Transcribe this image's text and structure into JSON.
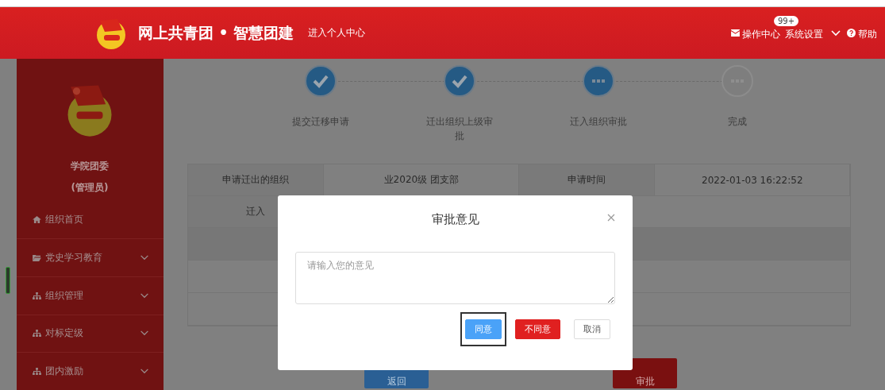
{
  "header": {
    "title": "网上共青团 • 智慧团建",
    "personal_link": "进入个人中心",
    "nav": [
      {
        "label": "操作中心",
        "kind": "mail",
        "badge": "99+"
      },
      {
        "label": "系统设置",
        "kind": "chevron"
      },
      {
        "label": "帮助",
        "kind": "help"
      }
    ]
  },
  "sidebar": {
    "org": "学院团委",
    "role": "(管理员)",
    "items": [
      {
        "label": "组织首页",
        "kind": "home",
        "expandable": false
      },
      {
        "label": "党史学习教育",
        "kind": "folder",
        "expandable": true
      },
      {
        "label": "组织管理",
        "kind": "sitemap",
        "expandable": true
      },
      {
        "label": "对标定级",
        "kind": "sitemap",
        "expandable": true
      },
      {
        "label": "团内激励",
        "kind": "sitemap",
        "expandable": true
      }
    ]
  },
  "steps": [
    {
      "label": "提交迁移申请",
      "kind": "done"
    },
    {
      "label": "迁出组织上级审批",
      "kind": "done"
    },
    {
      "label": "迁入组织审批",
      "kind": "active"
    },
    {
      "label": "完成",
      "kind": "pending"
    }
  ],
  "table": {
    "rows": [
      [
        {
          "text": "申请迁出的组织",
          "kind": "label"
        },
        {
          "text": "业2020级 团支部",
          "kind": "value"
        },
        {
          "text": "申请时间",
          "kind": "label"
        },
        {
          "text": "2022-01-03 16:22:52",
          "kind": "value"
        }
      ],
      [
        {
          "text": "迁入",
          "kind": "label"
        }
      ]
    ]
  },
  "actions": [
    {
      "label": "返回",
      "kind": "primary"
    },
    {
      "label": "审批",
      "kind": "danger"
    }
  ],
  "dialog": {
    "title": "审批意见",
    "placeholder": "请输入您的意见",
    "buttons": [
      {
        "label": "同意",
        "kind": "primary",
        "focused": true
      },
      {
        "label": "不同意",
        "kind": "danger",
        "focused": false
      },
      {
        "label": "取消",
        "kind": "plain",
        "focused": false
      }
    ]
  }
}
